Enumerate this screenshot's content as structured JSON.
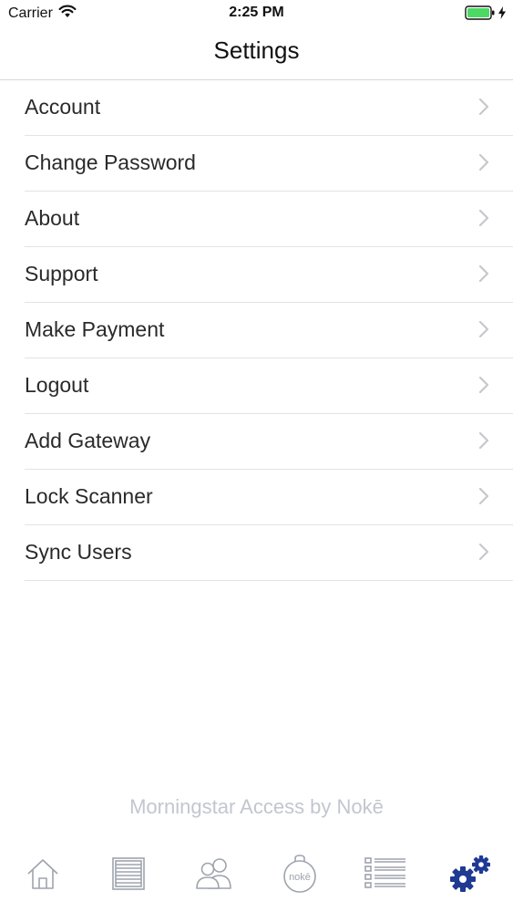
{
  "status_bar": {
    "carrier": "Carrier",
    "time": "2:25 PM",
    "battery_color": "#4cd964"
  },
  "nav": {
    "title": "Settings"
  },
  "menu": {
    "items": [
      {
        "label": "Account"
      },
      {
        "label": "Change Password"
      },
      {
        "label": "About"
      },
      {
        "label": "Support"
      },
      {
        "label": "Make Payment"
      },
      {
        "label": "Logout"
      },
      {
        "label": "Add Gateway"
      },
      {
        "label": "Lock Scanner"
      },
      {
        "label": "Sync Users"
      }
    ]
  },
  "footer": {
    "brand": "Morningstar Access by Nokē"
  },
  "tab_bar": {
    "inactive_color": "#9ea3ad",
    "active_color": "#1f3a93",
    "active_tab": "settings",
    "tabs": [
      {
        "id": "home",
        "icon": "home-icon"
      },
      {
        "id": "units",
        "icon": "storage-unit-icon"
      },
      {
        "id": "users",
        "icon": "users-icon"
      },
      {
        "id": "noke",
        "icon": "noke-lock-icon",
        "label": "nokē"
      },
      {
        "id": "activity",
        "icon": "checklist-icon"
      },
      {
        "id": "settings",
        "icon": "gears-icon"
      }
    ]
  }
}
